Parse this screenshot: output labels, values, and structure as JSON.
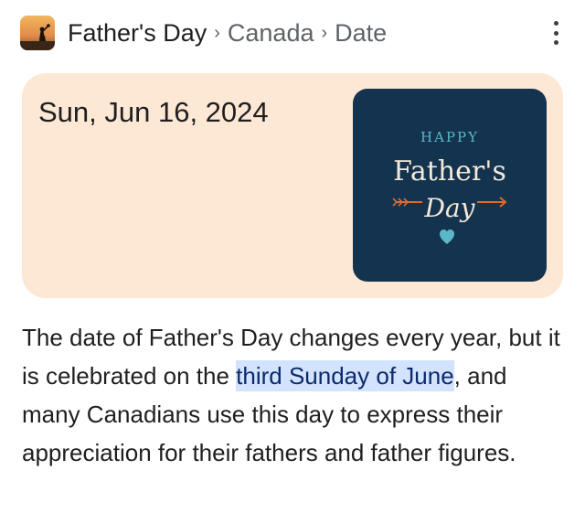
{
  "header": {
    "crumb_main": "Father's Day",
    "crumb_sep_1": "›",
    "crumb_2": "Canada",
    "crumb_sep_2": "›",
    "crumb_3": "Date"
  },
  "card": {
    "date": "Sun, Jun 16, 2024",
    "image": {
      "happy": "HAPPY",
      "fathers": "Father's",
      "day": "Day",
      "colors": {
        "background": "#14334f",
        "happy": "#5bb8c9",
        "fathers": "#f4ead8",
        "arrow": "#e06a2a",
        "heart": "#5bb8c9"
      }
    },
    "background_color": "#fde8d6"
  },
  "description": {
    "part1": "The date of Father's Day changes every year, but it is celebrated on the ",
    "highlight": "third Sunday of June",
    "part2": ", and many Canadians use this day to express their appreciation for their fathers and father figures."
  },
  "icons": {
    "thumbnail": "fathers-day-thumbnail",
    "menu": "more-vert-icon"
  }
}
